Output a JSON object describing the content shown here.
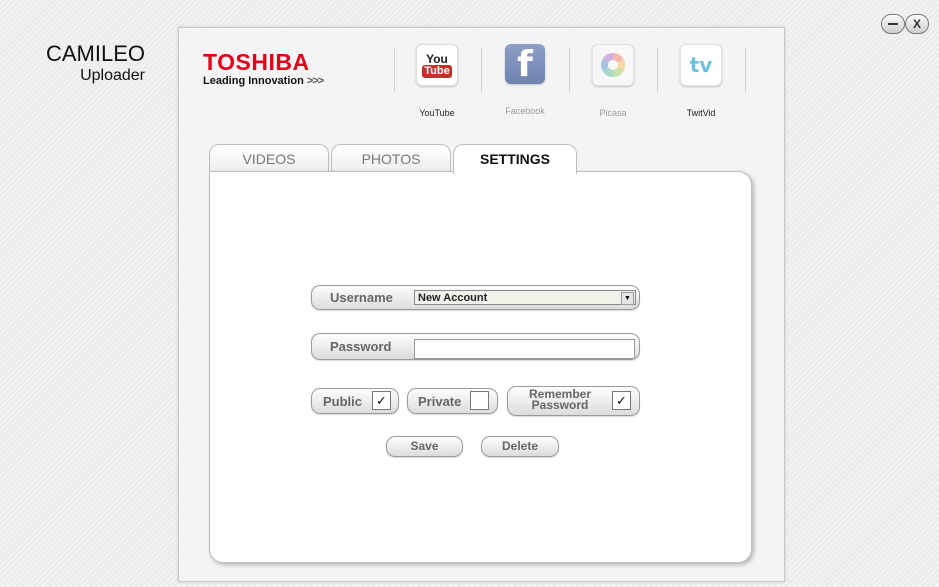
{
  "app": {
    "title_line1": "CAMILEO",
    "title_line2": "Uploader"
  },
  "window_controls": {
    "minimize_icon": "minimize-icon",
    "close_label": "X"
  },
  "brand": {
    "name": "TOSHIBA",
    "tagline": "Leading Innovation",
    "tagline_arrows": ">>>",
    "brand_color": "#e3001b"
  },
  "services": [
    {
      "label": "YouTube",
      "icon": "youtube-icon",
      "icon_text_top": "You",
      "icon_text_bottom": "Tube",
      "enabled": true
    },
    {
      "label": "Facebook",
      "icon": "facebook-icon",
      "icon_text": "f",
      "enabled": false
    },
    {
      "label": "Picasa",
      "icon": "picasa-icon",
      "enabled": false
    },
    {
      "label": "TwitVid",
      "icon": "twitvid-icon",
      "icon_text": "tv",
      "enabled": false
    }
  ],
  "tabs": [
    {
      "label": "VIDEOS",
      "active": false
    },
    {
      "label": "PHOTOS",
      "active": false
    },
    {
      "label": "SETTINGS",
      "active": true
    }
  ],
  "settings": {
    "username_label": "Username",
    "username_value": "New Account",
    "password_label": "Password",
    "password_value": "",
    "public_label": "Public",
    "public_checked": true,
    "private_label": "Private",
    "private_checked": false,
    "remember_label_line1": "Remember",
    "remember_label_line2": "Password",
    "remember_checked": true,
    "check_glyph": "✓",
    "save_label": "Save",
    "delete_label": "Delete"
  }
}
